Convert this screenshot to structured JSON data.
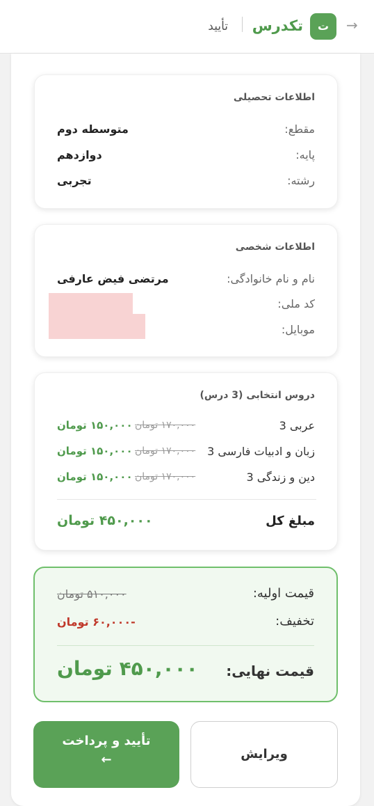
{
  "header": {
    "back_icon": "arrow-right-icon",
    "logo_letter": "ت",
    "brand": "تکدرس",
    "crumb": "تأیید"
  },
  "education": {
    "title": "اطلاعات تحصیلی",
    "rows": [
      {
        "label": "مقطع:",
        "value": "متوسطه دوم"
      },
      {
        "label": "پایه:",
        "value": "دوازدهم"
      },
      {
        "label": "رشته:",
        "value": "تجربی"
      }
    ]
  },
  "personal": {
    "title": "اطلاعات شخصی",
    "rows": [
      {
        "label": "نام و نام خانوادگی:",
        "value": "مرتضی فیض عارفی"
      },
      {
        "label": "کد ملی:",
        "value": ""
      },
      {
        "label": "موبایل:",
        "value": ""
      }
    ]
  },
  "courses": {
    "title": "دروس انتخابی (3 درس)",
    "items": [
      {
        "name": "عربی 3",
        "old_price": "۱۷۰,۰۰۰ تومان",
        "new_price": "۱۵۰,۰۰۰ تومان"
      },
      {
        "name": "زبان و ادبیات فارسی 3",
        "old_price": "۱۷۰,۰۰۰ تومان",
        "new_price": "۱۵۰,۰۰۰ تومان"
      },
      {
        "name": "دین و زندگی 3",
        "old_price": "۱۷۰,۰۰۰ تومان",
        "new_price": "۱۵۰,۰۰۰ تومان"
      }
    ],
    "total_label": "مبلغ کل",
    "total_value": "۴۵۰,۰۰۰ تومان"
  },
  "summary": {
    "initial_label": "قیمت اولیه:",
    "initial_value": "۵۱۰,۰۰۰ تومان",
    "discount_label": "تخفیف:",
    "discount_value": "-۶۰,۰۰۰ تومان",
    "final_label": "قیمت نهایی:",
    "final_value": "۴۵۰,۰۰۰ تومان"
  },
  "actions": {
    "edit_label": "ویرایش",
    "pay_label": "تأیید و پرداخت",
    "pay_icon": "arrow-left-icon"
  },
  "colors": {
    "accent": "#5aa257",
    "discount": "#c0392b",
    "redaction": "#f8d3d3"
  }
}
